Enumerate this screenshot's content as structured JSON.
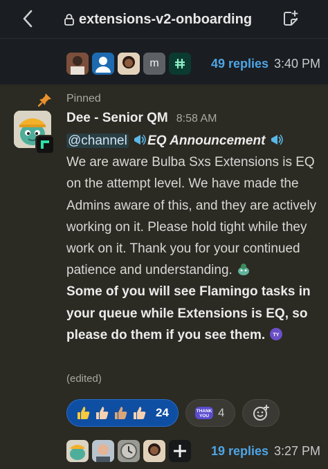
{
  "header": {
    "channel_name": "extensions-v2-onboarding"
  },
  "top_thread": {
    "avatars": [
      {
        "name": "avatar-photo-1",
        "kind": "photo"
      },
      {
        "name": "avatar-default",
        "kind": "default"
      },
      {
        "name": "avatar-photo-2",
        "kind": "photo"
      },
      {
        "name": "avatar-letter-m",
        "kind": "letter",
        "letter": "m"
      },
      {
        "name": "avatar-hash",
        "kind": "hash"
      }
    ],
    "replies_label": "49 replies",
    "time": "3:40 PM"
  },
  "pinned_message": {
    "pin_label": "Pinned",
    "author": "Dee - Senior QM",
    "time": "8:58 AM",
    "mention": "@channel",
    "announcement": "EQ Announcement",
    "body_text": "We are aware Bulba Sxs Extensions is EQ on the attempt level. We have made the Admins aware of this, and they are actively working on it. Please hold tight while they work on it. Thank you for your continued patience and understanding.",
    "bold_text": "Some of you will see Flamingo tasks in your queue while Extensions is EQ, so please do them if you see them.",
    "edited_label": "(edited)"
  },
  "reactions": {
    "main_count": "24",
    "thanks_count": "4"
  },
  "bottom_thread": {
    "replies_label": "19 replies",
    "time": "3:27 PM"
  },
  "colors": {
    "background": "#1a1d21",
    "pinned_bg": "#2b2a23",
    "link": "#4ea5e5",
    "reaction_active": "#0f4fa3"
  }
}
